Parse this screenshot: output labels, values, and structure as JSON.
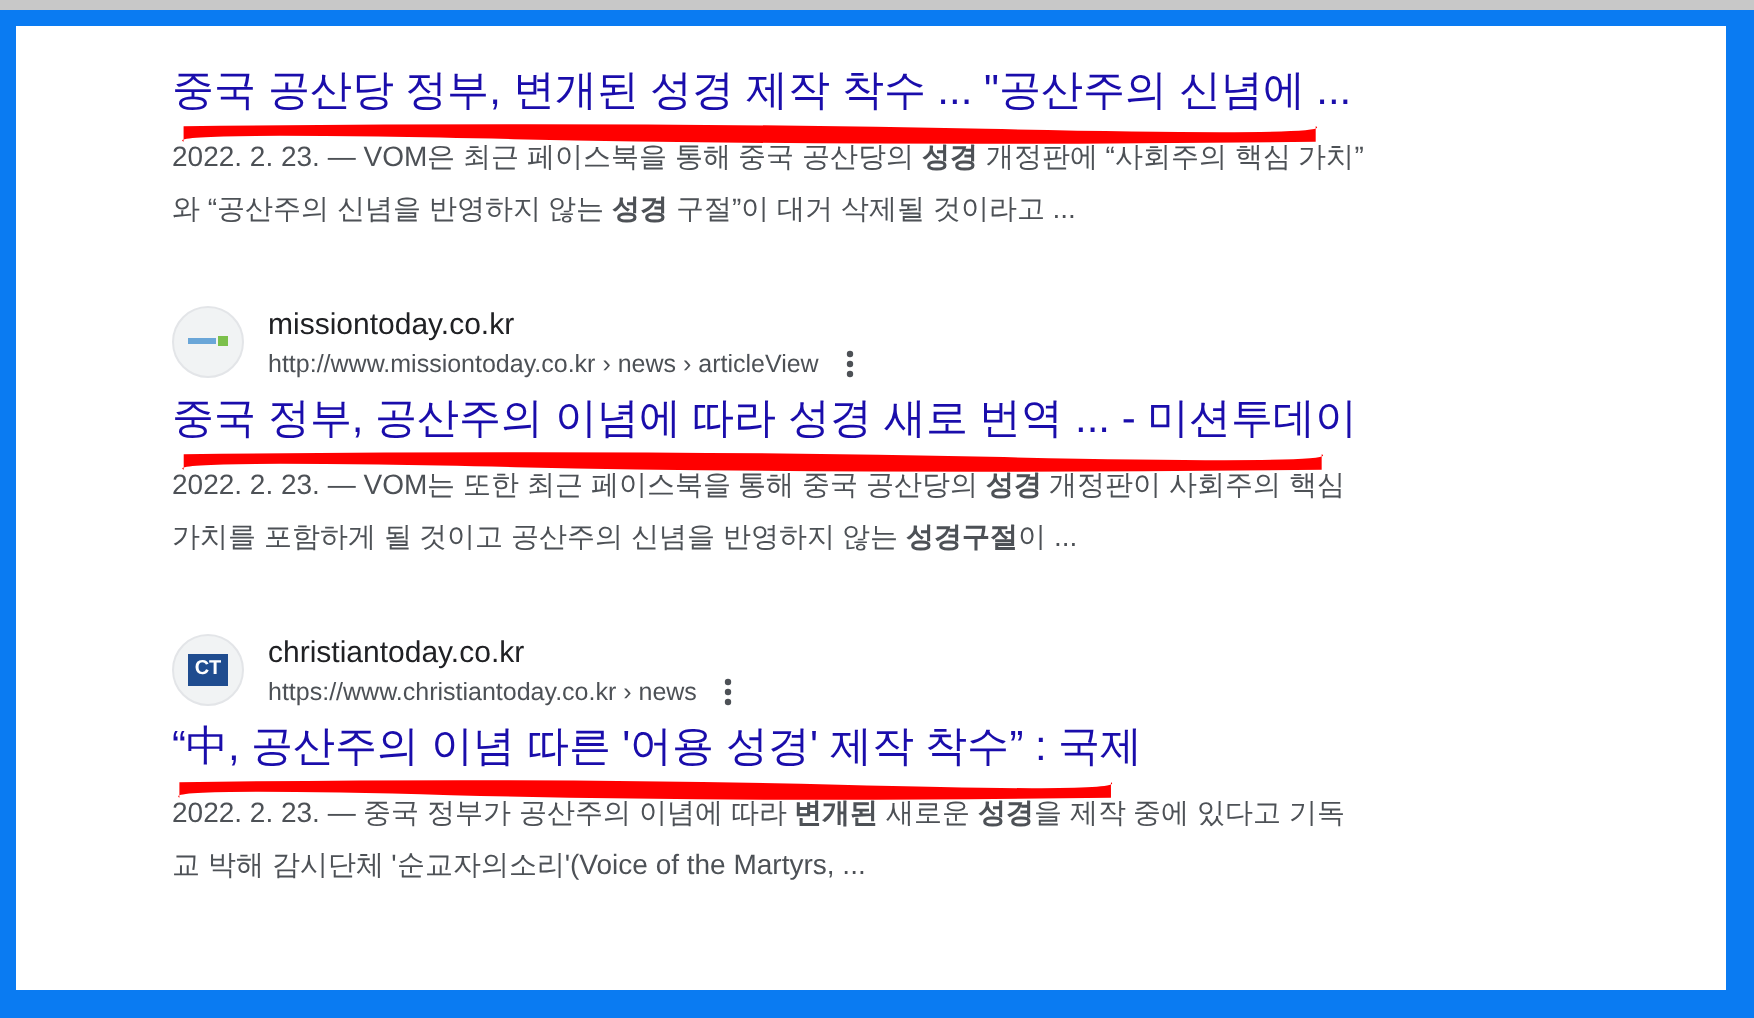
{
  "results": [
    {
      "title": "중국 공산당 정부, 변개된 성경 제작 착수 ... \"공산주의 신념에 ...",
      "marked": true,
      "snippet": "2022. 2. 23. — VOM은 최근 페이스북을 통해 중국 공산당의 **성경** 개정판에 “사회주의 핵심 가치”\n와 “공산주의 신념을 반영하지 않는 **성경** 구절”이 대거 삭제될 것이라고 ..."
    },
    {
      "site": "missiontoday.co.kr",
      "url": "http://www.missiontoday.co.kr › news › articleView",
      "favicon": {
        "kind": "logo"
      },
      "title": "중국 정부, 공산주의 이념에 따라 성경 새로 번역 ... - 미션투데이",
      "marked": true,
      "snippet": "2022. 2. 23. — VOM는 또한 최근 페이스북을 통해 중국 공산당의 **성경** 개정판이 사회주의 핵심\n가치를 포함하게 될 것이고 공산주의 신념을 반영하지 않는 **성경구절**이 ..."
    },
    {
      "site": "christiantoday.co.kr",
      "url": "https://www.christiantoday.co.kr › news",
      "favicon": {
        "kind": "text",
        "text": "CT"
      },
      "title": "“中, 공산주의 이념 따른 '어용 성경' 제작 착수” : 국제",
      "marked": true,
      "snippet": "2022. 2. 23. — 중국 정부가 공산주의 이념에 따라 **변개된** 새로운 **성경**을 제작 중에 있다고 기독\n교 박해 감시단체 '순교자의소리'(Voice of the Martyrs, ..."
    }
  ]
}
